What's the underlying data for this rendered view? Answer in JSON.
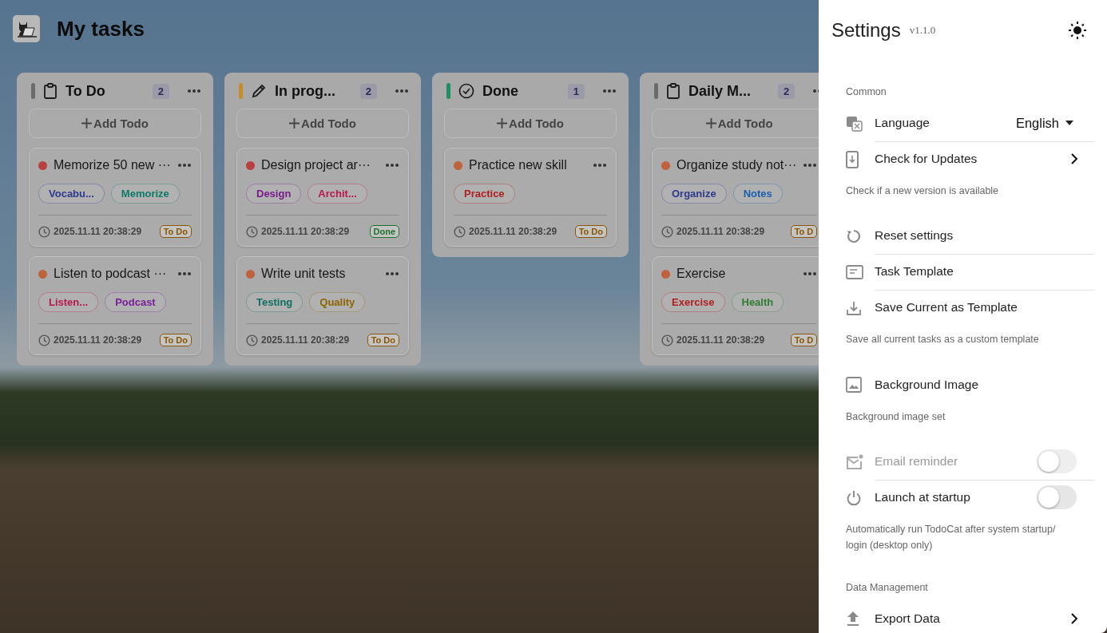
{
  "app": {
    "title": "My tasks"
  },
  "columns": [
    {
      "title": "To Do",
      "color": "#6b6b6b",
      "count": "2",
      "action": "Add Todo",
      "cards": [
        {
          "title": "Memorize 50 new ···",
          "color": "#b8403f",
          "tags": [
            {
              "label": "Vocabu...",
              "color": "#2e3a8c"
            },
            {
              "label": "Memorize",
              "color": "#0d7a68"
            }
          ],
          "time": "2025.11.11 20:38:29",
          "status": {
            "label": "To Do",
            "color": "#8a5600"
          }
        },
        {
          "title": "Listen to podcast ···",
          "color": "#bf623e",
          "tags": [
            {
              "label": "Listen...",
              "color": "#b8174f"
            },
            {
              "label": "Podcast",
              "color": "#7a1f9a"
            }
          ],
          "time": "2025.11.11 20:38:29",
          "status": {
            "label": "To Do",
            "color": "#8a5600"
          }
        }
      ]
    },
    {
      "title": "In prog...",
      "color": "#c98a2a",
      "count": "2",
      "action": "Add Todo",
      "cards": [
        {
          "title": "Design project ar···",
          "color": "#b8403f",
          "tags": [
            {
              "label": "Design",
              "color": "#7a1a8c"
            },
            {
              "label": "Archit...",
              "color": "#b8174f"
            }
          ],
          "time": "2025.11.11 20:38:29",
          "status": {
            "label": "Done",
            "color": "#1f6e2a"
          }
        },
        {
          "title": "Write unit tests",
          "color": "#bf623e",
          "tags": [
            {
              "label": "Testing",
              "color": "#0d7064"
            },
            {
              "label": "Quality",
              "color": "#8f6400"
            }
          ],
          "time": "2025.11.11 20:38:29",
          "status": {
            "label": "To Do",
            "color": "#8a5600"
          }
        }
      ]
    },
    {
      "title": "Done",
      "color": "#1f8f5f",
      "count": "1",
      "action": "Add Todo",
      "cards": [
        {
          "title": "Practice new skill",
          "color": "#bf623e",
          "tags": [
            {
              "label": "Practice",
              "color": "#b0201f"
            }
          ],
          "time": "2025.11.11 20:38:29",
          "status": {
            "label": "To Do",
            "color": "#8a5600"
          }
        }
      ]
    },
    {
      "title": "Daily M...",
      "color": "#6b6b6b",
      "count": "2",
      "action": "Add Todo",
      "cards": [
        {
          "title": "Organize study not···",
          "color": "#bf623e",
          "tags": [
            {
              "label": "Organize",
              "color": "#2e3a8c"
            },
            {
              "label": "Notes",
              "color": "#1a5fb0"
            }
          ],
          "time": "2025.11.11 20:38:29",
          "status": {
            "label": "To D",
            "color": "#8a5600"
          }
        },
        {
          "title": "Exercise",
          "color": "#bf623e",
          "tags": [
            {
              "label": "Exercise",
              "color": "#b0201f"
            },
            {
              "label": "Health",
              "color": "#2e7d32"
            }
          ],
          "time": "2025.11.11 20:38:29",
          "status": {
            "label": "To D",
            "color": "#8a5600"
          }
        }
      ]
    }
  ],
  "settings": {
    "title": "Settings",
    "version": "v1.1.0",
    "rows": [
      {
        "kind": "heading",
        "text": "Common"
      },
      {
        "kind": "select",
        "label": "Language",
        "value": "English"
      },
      {
        "kind": "nav",
        "label": "Check for Updates"
      },
      {
        "kind": "note",
        "text": "Check if a new version is available"
      },
      {
        "kind": "action",
        "label": "Reset settings"
      },
      {
        "kind": "action",
        "label": "Task Template"
      },
      {
        "kind": "action",
        "label": "Save Current as Template"
      },
      {
        "kind": "note",
        "text": "Save all current tasks as a custom template"
      },
      {
        "kind": "action",
        "label": "Background Image"
      },
      {
        "kind": "note",
        "text": "Background image set"
      },
      {
        "kind": "toggle",
        "label": "Email reminder",
        "on": false,
        "disabled": true
      },
      {
        "kind": "toggle",
        "label": "Launch at startup",
        "on": false,
        "disabled": false
      },
      {
        "kind": "note",
        "text": "Automatically run TodoCat after system startup/ login (desktop only)"
      },
      {
        "kind": "heading",
        "text": "Data Management"
      },
      {
        "kind": "nav",
        "label": "Export Data"
      }
    ]
  }
}
